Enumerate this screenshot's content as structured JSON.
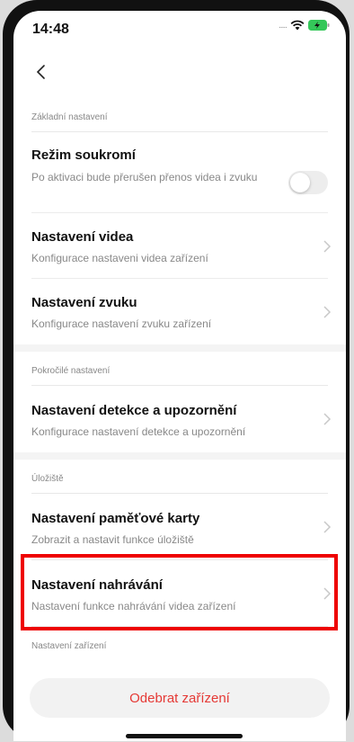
{
  "status_bar": {
    "time": "14:48",
    "signal": "....."
  },
  "sections": {
    "basic": {
      "header": "Základní nastavení",
      "privacy": {
        "title": "Režim soukromí",
        "subtitle": "Po aktivaci bude přerušen přenos videa i zvuku",
        "enabled": false
      },
      "video": {
        "title": "Nastavení videa",
        "subtitle": "Konfigurace nastaveni videa zařízení"
      },
      "audio": {
        "title": "Nastavení zvuku",
        "subtitle": "Konfigurace nastavení zvuku zařízení"
      }
    },
    "advanced": {
      "header": "Pokročilé nastavení",
      "detection": {
        "title": "Nastavení detekce a upozornění",
        "subtitle": "Konfigurace nastavení detekce a upozornění"
      }
    },
    "storage": {
      "header": "Úložiště",
      "memory_card": {
        "title": "Nastavení paměťové karty",
        "subtitle": "Zobrazit a nastavit funkce úložiště"
      },
      "recording": {
        "title": "Nastavení nahrávání",
        "subtitle": "Nastavení funkce nahrávání videa zařízení"
      }
    },
    "device": {
      "header": "Nastavení zařízení"
    }
  },
  "remove_button": "Odebrat zařízení",
  "colors": {
    "highlight": "#ee0000",
    "danger": "#e53935"
  }
}
